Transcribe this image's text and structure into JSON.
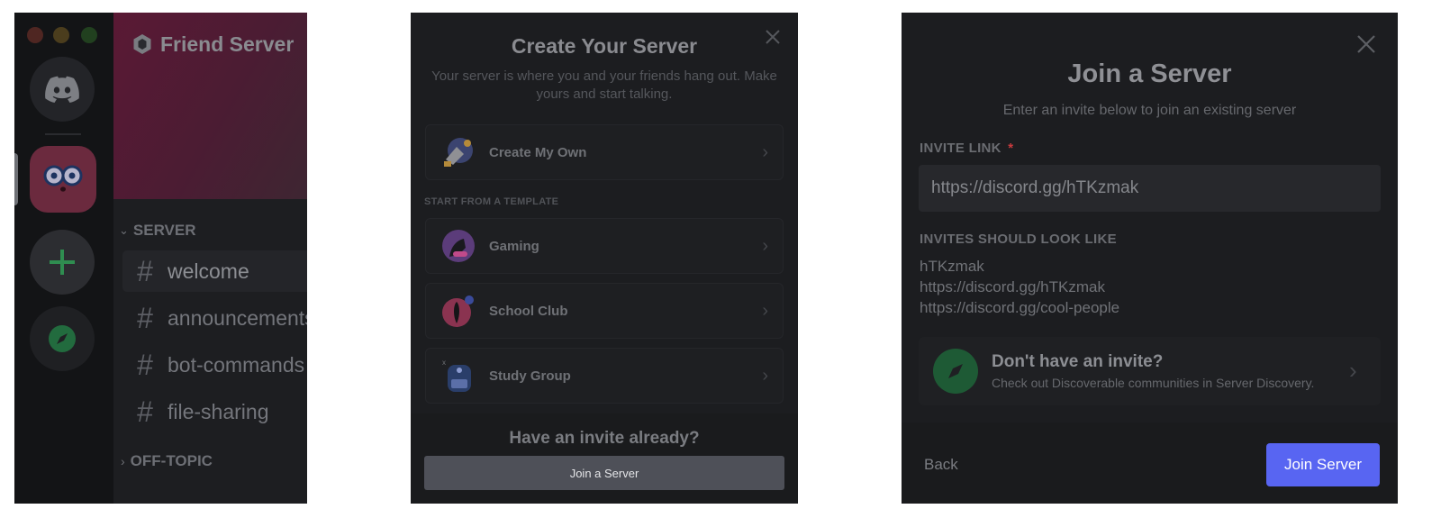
{
  "app_panel": {
    "server_name": "Friend Server",
    "categories": {
      "server": "SERVER",
      "off_topic": "OFF-TOPIC"
    },
    "channels": [
      {
        "name": "welcome",
        "active": true
      },
      {
        "name": "announcements"
      },
      {
        "name": "bot-commands"
      },
      {
        "name": "file-sharing"
      }
    ],
    "icons": [
      "discord-home-icon",
      "server-avatar-icon",
      "add-server-icon",
      "explore-compass-icon"
    ],
    "colors": {
      "banner": "#5a1934",
      "add_icon": "#3ba55d",
      "avatar_bg": "#d9456a"
    }
  },
  "create_modal": {
    "title": "Create Your Server",
    "subtitle": "Your server is where you and your friends hang out. Make yours and start talking.",
    "create_own": "Create My Own",
    "template_heading": "START FROM A TEMPLATE",
    "templates": [
      "Gaming",
      "School Club",
      "Study Group"
    ],
    "invite_prompt": "Have an invite already?",
    "join_button": "Join a Server"
  },
  "join_modal": {
    "title": "Join a Server",
    "subtitle": "Enter an invite below to join an existing server",
    "invite_label": "INVITE LINK",
    "required_mark": "*",
    "invite_value": "https://discord.gg/hTKzmak",
    "examples_label": "INVITES SHOULD LOOK LIKE",
    "examples": [
      "hTKzmak",
      "https://discord.gg/hTKzmak",
      "https://discord.gg/cool-people"
    ],
    "discover_title": "Don't have an invite?",
    "discover_subtitle": "Check out Discoverable communities in Server Discovery.",
    "back_button": "Back",
    "join_button": "Join Server",
    "colors": {
      "primary": "#5865f2",
      "required": "#c93b3e"
    }
  }
}
